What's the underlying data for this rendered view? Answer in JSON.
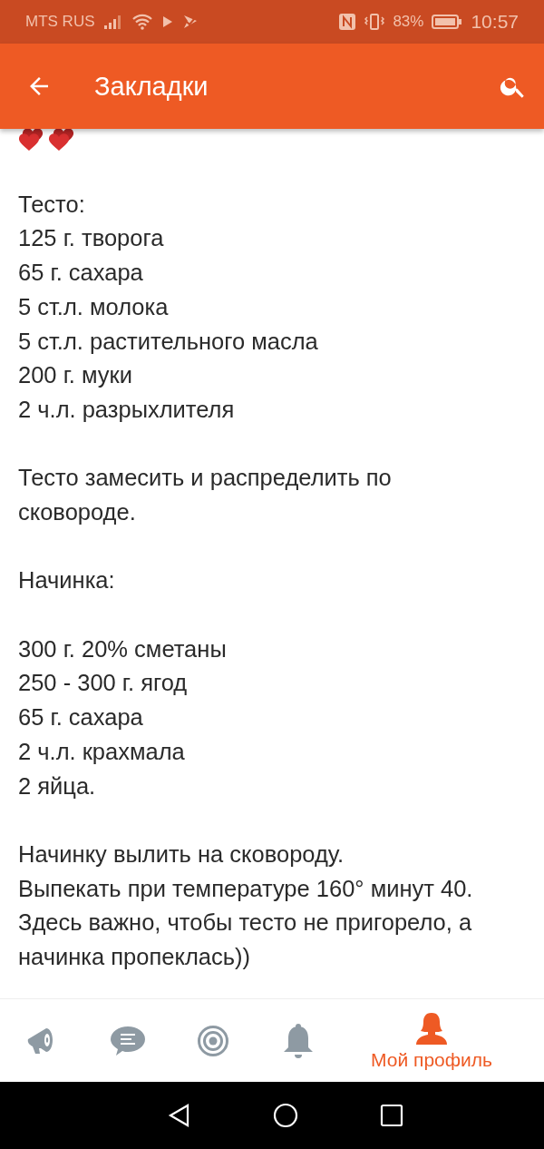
{
  "status_bar": {
    "carrier": "MTS RUS",
    "battery": "83%",
    "time": "10:57"
  },
  "app_bar": {
    "title": "Закладки"
  },
  "post": {
    "paragraphs": [
      [
        "Тесто:",
        "125 г. творога",
        "65 г. сахара",
        "5 ст.л. молока",
        "5 ст.л. растительного масла",
        "200 г. муки",
        "2 ч.л. разрыхлителя"
      ],
      [
        "Тесто замесить и распределить по сковороде."
      ],
      [
        "Начинка:"
      ],
      [
        "300 г. 20% сметаны",
        "250 - 300 г. ягод",
        "65 г. сахара",
        "2 ч.л. крахмала",
        "2 яйца."
      ],
      [
        "Начинку вылить на сковороду.",
        "Выпекать при температуре 160° минут 40.",
        "Здесь важно, чтобы тесто не пригорело, а начинка пропеклась))"
      ]
    ]
  },
  "bottom_nav": [
    {
      "kind": "megaphone",
      "selected": false
    },
    {
      "kind": "chat",
      "selected": false
    },
    {
      "kind": "target",
      "selected": false
    },
    {
      "kind": "bell",
      "selected": false
    },
    {
      "kind": "profile",
      "label": "Мой профиль",
      "selected": true
    }
  ]
}
